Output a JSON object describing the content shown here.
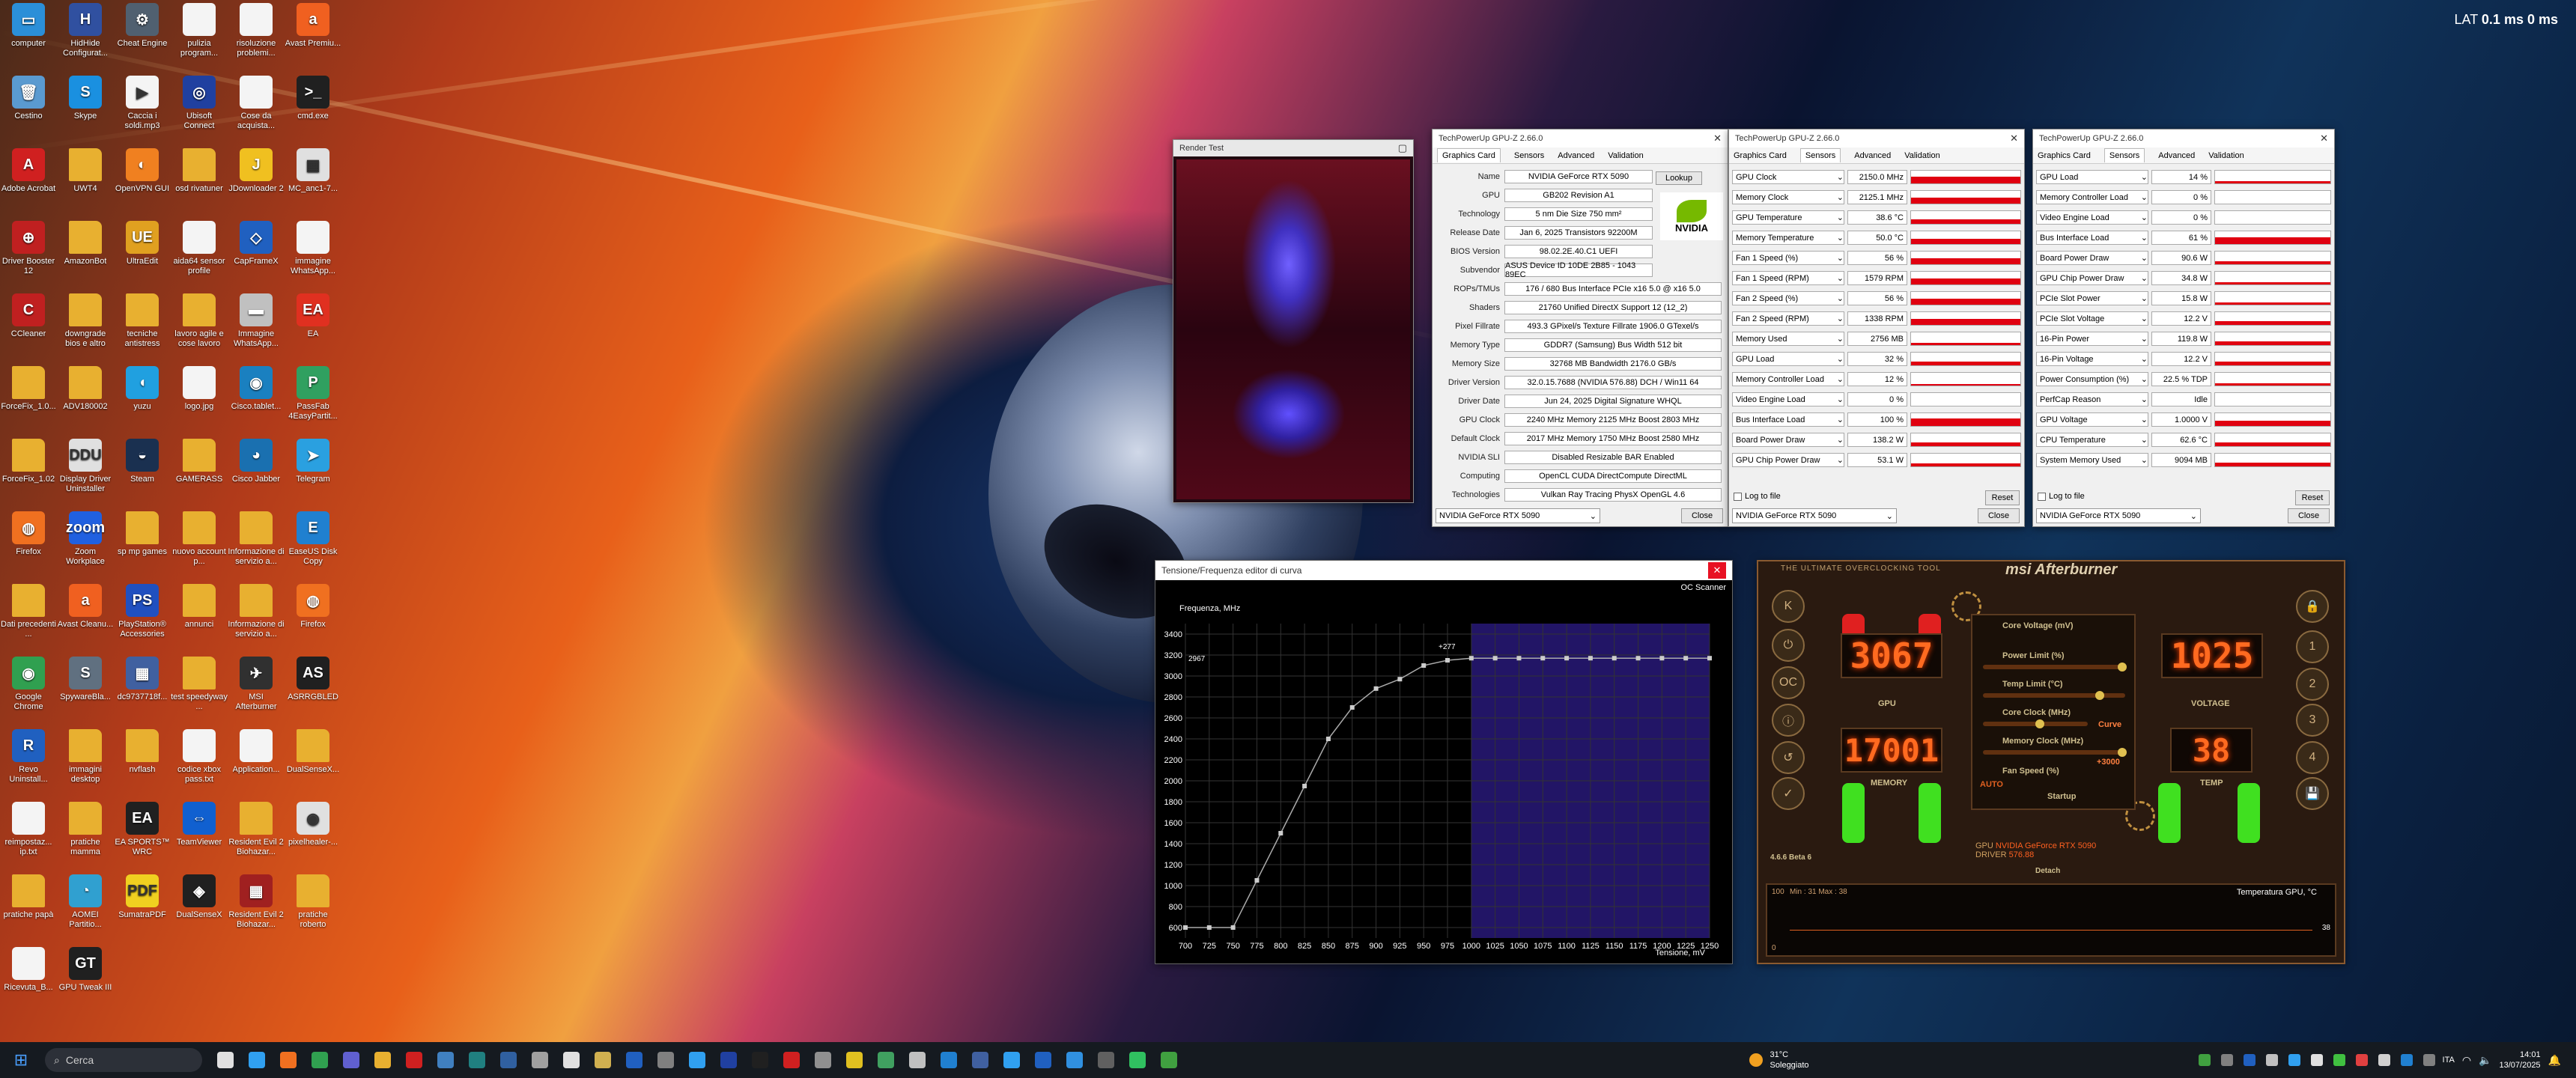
{
  "topbar": {
    "lat_label": "LAT",
    "lat_value": "0.1 ms 0 ms"
  },
  "desktop_icons": [
    {
      "label": "computer",
      "color": "#2b8fd8",
      "glyph": "▭"
    },
    {
      "label": "HidHide Configurat...",
      "color": "#3050a0",
      "glyph": "H"
    },
    {
      "label": "Cheat Engine",
      "color": "#506070",
      "glyph": "⚙"
    },
    {
      "label": "pulizia program...",
      "color": "#f4f4f4",
      "glyph": ""
    },
    {
      "label": "risoluzione problemi...",
      "color": "#f4f4f4",
      "glyph": ""
    },
    {
      "label": "Avast Premiu...",
      "color": "#f06020",
      "glyph": "a"
    },
    {
      "label": "Cestino",
      "color": "#5a9ad0",
      "glyph": "🗑"
    },
    {
      "label": "Skype",
      "color": "#1a90e0",
      "glyph": "S"
    },
    {
      "label": "Caccia i soldi.mp3",
      "color": "#f4f4f4",
      "glyph": "▶"
    },
    {
      "label": "Ubisoft Connect",
      "color": "#2040a0",
      "glyph": "◎"
    },
    {
      "label": "Cose da acquista...",
      "color": "#f4f4f4",
      "glyph": ""
    },
    {
      "label": "cmd.exe",
      "color": "#202020",
      "glyph": ">_"
    },
    {
      "label": "Adobe Acrobat",
      "color": "#d02020",
      "glyph": "A"
    },
    {
      "label": "UWT4",
      "color": "#e8b030",
      "glyph": ""
    },
    {
      "label": "OpenVPN GUI",
      "color": "#f08020",
      "glyph": "◐"
    },
    {
      "label": "osd rivatuner",
      "color": "#e8b030",
      "glyph": ""
    },
    {
      "label": "JDownloader 2",
      "color": "#f0c020",
      "glyph": "J"
    },
    {
      "label": "MC_anc1-7...",
      "color": "#e0e0e0",
      "glyph": "▦"
    },
    {
      "label": "Driver Booster 12",
      "color": "#c02020",
      "glyph": "⊕"
    },
    {
      "label": "AmazonBot",
      "color": "#e8b030",
      "glyph": ""
    },
    {
      "label": "UltraEdit",
      "color": "#e0a020",
      "glyph": "UE"
    },
    {
      "label": "aida64 sensor profile",
      "color": "#f4f4f4",
      "glyph": ""
    },
    {
      "label": "CapFrameX",
      "color": "#2060c0",
      "glyph": "◇"
    },
    {
      "label": "immagine WhatsApp...",
      "color": "#f4f4f4",
      "glyph": ""
    },
    {
      "label": "CCleaner",
      "color": "#c02020",
      "glyph": "C"
    },
    {
      "label": "downgrade bios e altro",
      "color": "#e8b030",
      "glyph": ""
    },
    {
      "label": "tecniche antistress",
      "color": "#e8b030",
      "glyph": ""
    },
    {
      "label": "lavoro agile e cose lavoro",
      "color": "#e8b030",
      "glyph": ""
    },
    {
      "label": "Immagine WhatsApp...",
      "color": "#c0c0c0",
      "glyph": "▬"
    },
    {
      "label": "EA",
      "color": "#e03020",
      "glyph": "EA"
    },
    {
      "label": "ForceFix_1.0...",
      "color": "#e8b030",
      "glyph": ""
    },
    {
      "label": "ADV180002",
      "color": "#e8b030",
      "glyph": ""
    },
    {
      "label": "yuzu",
      "color": "#20a0e0",
      "glyph": "◖"
    },
    {
      "label": "logo.jpg",
      "color": "#f4f4f4",
      "glyph": ""
    },
    {
      "label": "Cisco.tablet...",
      "color": "#1a80c0",
      "glyph": "◉"
    },
    {
      "label": "PassFab 4EasyPartit...",
      "color": "#30a060",
      "glyph": "P"
    },
    {
      "label": "ForceFix_1.02",
      "color": "#e8b030",
      "glyph": ""
    },
    {
      "label": "Display Driver Uninstaller",
      "color": "#e0e0e0",
      "glyph": "DDU"
    },
    {
      "label": "Steam",
      "color": "#1a3050",
      "glyph": "◒"
    },
    {
      "label": "GAMERASS",
      "color": "#e8b030",
      "glyph": ""
    },
    {
      "label": "Cisco Jabber",
      "color": "#1a70b0",
      "glyph": "◕"
    },
    {
      "label": "Telegram",
      "color": "#2aa0e0",
      "glyph": "➤"
    },
    {
      "label": "Firefox",
      "color": "#f07020",
      "glyph": "◍"
    },
    {
      "label": "Zoom Workplace",
      "color": "#2060e0",
      "glyph": "zoom"
    },
    {
      "label": "sp mp games",
      "color": "#e8b030",
      "glyph": ""
    },
    {
      "label": "nuovo account p...",
      "color": "#e8b030",
      "glyph": ""
    },
    {
      "label": "Informazione di servizio a...",
      "color": "#e8b030",
      "glyph": ""
    },
    {
      "label": "EaseUS Disk Copy",
      "color": "#2080d0",
      "glyph": "E"
    },
    {
      "label": "Dati precedenti ...",
      "color": "#e8b030",
      "glyph": ""
    },
    {
      "label": "Avast Cleanu...",
      "color": "#f06020",
      "glyph": "a"
    },
    {
      "label": "PlayStation® Accessories",
      "color": "#2050c0",
      "glyph": "PS"
    },
    {
      "label": "annunci",
      "color": "#e8b030",
      "glyph": ""
    },
    {
      "label": "Informazione di servizio a...",
      "color": "#e8b030",
      "glyph": ""
    },
    {
      "label": "Firefox",
      "color": "#f07020",
      "glyph": "◍"
    },
    {
      "label": "Google Chrome",
      "color": "#30a050",
      "glyph": "◉"
    },
    {
      "label": "SpywareBla...",
      "color": "#607080",
      "glyph": "S"
    },
    {
      "label": "dc9737718f...",
      "color": "#4060a0",
      "glyph": "▦"
    },
    {
      "label": "test speedyway ...",
      "color": "#e8b030",
      "glyph": ""
    },
    {
      "label": "MSI Afterburner",
      "color": "#303030",
      "glyph": "✈"
    },
    {
      "label": "ASRRGBLED",
      "color": "#202020",
      "glyph": "AS"
    },
    {
      "label": "Revo Uninstall...",
      "color": "#2060c0",
      "glyph": "R"
    },
    {
      "label": "immagini desktop",
      "color": "#e8b030",
      "glyph": ""
    },
    {
      "label": "nvflash",
      "color": "#e8b030",
      "glyph": ""
    },
    {
      "label": "codice xbox pass.txt",
      "color": "#f4f4f4",
      "glyph": ""
    },
    {
      "label": "Application...",
      "color": "#f4f4f4",
      "glyph": ""
    },
    {
      "label": "DualSenseX...",
      "color": "#e8b030",
      "glyph": ""
    },
    {
      "label": "reimpostaz... ip.txt",
      "color": "#f4f4f4",
      "glyph": ""
    },
    {
      "label": "pratiche mamma",
      "color": "#e8b030",
      "glyph": ""
    },
    {
      "label": "EA SPORTS™ WRC",
      "color": "#202020",
      "glyph": "EA"
    },
    {
      "label": "TeamViewer",
      "color": "#1060d0",
      "glyph": "⇔"
    },
    {
      "label": "Resident Evil 2 Biohazar...",
      "color": "#e8b030",
      "glyph": ""
    },
    {
      "label": "pixelhealer-...",
      "color": "#e0e0e0",
      "glyph": "◉"
    },
    {
      "label": "pratiche papà",
      "color": "#e8b030",
      "glyph": ""
    },
    {
      "label": "AOMEI Partitio...",
      "color": "#30a0d0",
      "glyph": "◔"
    },
    {
      "label": "SumatraPDF",
      "color": "#f0d020",
      "glyph": "PDF"
    },
    {
      "label": "DualSenseX",
      "color": "#202020",
      "glyph": "◈"
    },
    {
      "label": "Resident Evil 2 Biohazar...",
      "color": "#a02020",
      "glyph": "▦"
    },
    {
      "label": "pratiche roberto",
      "color": "#e8b030",
      "glyph": ""
    },
    {
      "label": "Ricevuta_B...",
      "color": "#f4f4f4",
      "glyph": ""
    },
    {
      "label": "GPU Tweak III",
      "color": "#202020",
      "glyph": "GT"
    }
  ],
  "render_test": {
    "title": "Render Test"
  },
  "gpuz1": {
    "title": "TechPowerUp GPU-Z 2.66.0",
    "tabs": [
      "Graphics Card",
      "Sensors",
      "Advanced",
      "Validation"
    ],
    "rows": [
      {
        "label": "Name",
        "value": "NVIDIA GeForce RTX 5090"
      },
      {
        "label": "GPU",
        "value": "GB202   Revision   A1"
      },
      {
        "label": "Technology",
        "value": "5 nm   Die Size   750 mm²"
      },
      {
        "label": "Release Date",
        "value": "Jan 6, 2025   Transistors   92200M"
      },
      {
        "label": "BIOS Version",
        "value": "98.02.2E.40.C1   UEFI"
      },
      {
        "label": "Subvendor",
        "value": "ASUS   Device ID   10DE 2B85 - 1043 89EC"
      },
      {
        "label": "ROPs/TMUs",
        "value": "176 / 680   Bus Interface   PCIe x16 5.0 @ x16 5.0"
      },
      {
        "label": "Shaders",
        "value": "21760 Unified   DirectX Support   12 (12_2)"
      },
      {
        "label": "Pixel Fillrate",
        "value": "493.3 GPixel/s   Texture Fillrate   1906.0 GTexel/s"
      },
      {
        "label": "Memory Type",
        "value": "GDDR7 (Samsung)   Bus Width   512 bit"
      },
      {
        "label": "Memory Size",
        "value": "32768 MB   Bandwidth   2176.0 GB/s"
      },
      {
        "label": "Driver Version",
        "value": "32.0.15.7688 (NVIDIA 576.88) DCH / Win11 64"
      },
      {
        "label": "Driver Date",
        "value": "Jun 24, 2025   Digital Signature   WHQL"
      },
      {
        "label": "GPU Clock",
        "value": "2240 MHz   Memory   2125 MHz   Boost   2803 MHz"
      },
      {
        "label": "Default Clock",
        "value": "2017 MHz   Memory   1750 MHz   Boost   2580 MHz"
      },
      {
        "label": "NVIDIA SLI",
        "value": "Disabled   Resizable BAR   Enabled"
      },
      {
        "label": "Computing",
        "value": "OpenCL   CUDA   DirectCompute   DirectML"
      },
      {
        "label": "Technologies",
        "value": "Vulkan   Ray Tracing   PhysX   OpenGL 4.6"
      }
    ],
    "lookup": "Lookup",
    "device": "NVIDIA GeForce RTX 5090",
    "close": "Close",
    "logo": "NVIDIA"
  },
  "gpuz2": {
    "title": "TechPowerUp GPU-Z 2.66.0",
    "tabs": [
      "Graphics Card",
      "Sensors",
      "Advanced",
      "Validation"
    ],
    "sensors": [
      {
        "name": "GPU Clock",
        "value": "2150.0 MHz",
        "fill": 0.55
      },
      {
        "name": "Memory Clock",
        "value": "2125.1 MHz",
        "fill": 0.45
      },
      {
        "name": "GPU Temperature",
        "value": "38.6 °C",
        "fill": 0.35
      },
      {
        "name": "Memory Temperature",
        "value": "50.0 °C",
        "fill": 0.4
      },
      {
        "name": "Fan 1 Speed (%)",
        "value": "56 %",
        "fill": 0.45
      },
      {
        "name": "Fan 1 Speed (RPM)",
        "value": "1579 RPM",
        "fill": 0.45
      },
      {
        "name": "Fan 2 Speed (%)",
        "value": "56 %",
        "fill": 0.45
      },
      {
        "name": "Fan 2 Speed (RPM)",
        "value": "1338 RPM",
        "fill": 0.45
      },
      {
        "name": "Memory Used",
        "value": "2756 MB",
        "fill": 0.15
      },
      {
        "name": "GPU Load",
        "value": "32 %",
        "fill": 0.3
      },
      {
        "name": "Memory Controller Load",
        "value": "12 %",
        "fill": 0.1
      },
      {
        "name": "Video Engine Load",
        "value": "0 %",
        "fill": 0
      },
      {
        "name": "Bus Interface Load",
        "value": "100 %",
        "fill": 0.6
      },
      {
        "name": "Board Power Draw",
        "value": "138.2 W",
        "fill": 0.3
      },
      {
        "name": "GPU Chip Power Draw",
        "value": "53.1 W",
        "fill": 0.25
      }
    ],
    "log": "Log to file",
    "reset": "Reset",
    "device": "NVIDIA GeForce RTX 5090",
    "close": "Close"
  },
  "gpuz3": {
    "title": "TechPowerUp GPU-Z 2.66.0",
    "tabs": [
      "Graphics Card",
      "Sensors",
      "Advanced",
      "Validation"
    ],
    "sensors": [
      {
        "name": "GPU Load",
        "value": "14 %",
        "fill": 0.15
      },
      {
        "name": "Memory Controller Load",
        "value": "0 %",
        "fill": 0
      },
      {
        "name": "Video Engine Load",
        "value": "0 %",
        "fill": 0
      },
      {
        "name": "Bus Interface Load",
        "value": "61 %",
        "fill": 0.55
      },
      {
        "name": "Board Power Draw",
        "value": "90.6 W",
        "fill": 0.25
      },
      {
        "name": "GPU Chip Power Draw",
        "value": "34.8 W",
        "fill": 0.2
      },
      {
        "name": "PCIe Slot Power",
        "value": "15.8 W",
        "fill": 0.2
      },
      {
        "name": "PCIe Slot Voltage",
        "value": "12.2 V",
        "fill": 0.3
      },
      {
        "name": "16-Pin Power",
        "value": "119.8 W",
        "fill": 0.3
      },
      {
        "name": "16-Pin Voltage",
        "value": "12.2 V",
        "fill": 0.3
      },
      {
        "name": "Power Consumption (%)",
        "value": "22.5 % TDP",
        "fill": 0.2
      },
      {
        "name": "PerfCap Reason",
        "value": "Idle",
        "fill": 0
      },
      {
        "name": "GPU Voltage",
        "value": "1.0000 V",
        "fill": 0.4
      },
      {
        "name": "CPU Temperature",
        "value": "62.6 °C",
        "fill": 0.3
      },
      {
        "name": "System Memory Used",
        "value": "9094 MB",
        "fill": 0.3
      }
    ],
    "log": "Log to file",
    "reset": "Reset",
    "device": "NVIDIA GeForce RTX 5090",
    "close": "Close"
  },
  "curve_editor": {
    "title": "Tensione/Frequenza editor di curva",
    "oc_scanner": "OC Scanner",
    "close": "✕",
    "ylabel": "Frequenza, MHz",
    "xlabel": "Tensione, mV",
    "marker": "+277",
    "current_freq": "2967"
  },
  "chart_data": {
    "type": "line",
    "xlabel": "Tensione, mV",
    "ylabel": "Frequenza, MHz",
    "x": [
      700,
      725,
      750,
      775,
      800,
      825,
      850,
      875,
      900,
      925,
      950,
      975,
      1000,
      1025,
      1050,
      1075,
      1100,
      1125,
      1150,
      1175,
      1200,
      1225,
      1250
    ],
    "xticks": [
      "700",
      "725",
      "750",
      "775",
      "800",
      "825",
      "850",
      "875",
      "900",
      "925",
      "950",
      "975",
      "1000",
      "1025",
      "1050",
      "1075",
      "1100",
      "1125",
      "1150",
      "1175",
      "1200",
      "1225",
      "1250"
    ],
    "yticks": [
      "600",
      "800",
      "1000",
      "1200",
      "1400",
      "1600",
      "1800",
      "2000",
      "2200",
      "2400",
      "2600",
      "2800",
      "3000",
      "3200",
      "3400"
    ],
    "ylim": [
      500,
      3500
    ],
    "xlim": [
      700,
      1250
    ],
    "series": [
      {
        "values": [
          600,
          600,
          600,
          1050,
          1500,
          1950,
          2400,
          2700,
          2880,
          2970,
          3100,
          3150,
          3170,
          3170,
          3170,
          3170,
          3170,
          3170,
          3170,
          3170,
          3170,
          3170,
          3170
        ]
      }
    ],
    "highlight_from": 1000
  },
  "afterburner": {
    "brand": "msi Afterburner",
    "tagline": "THE ULTIMATE OVERCLOCKING TOOL",
    "gpu_clock": "3067",
    "mem_clock": "17001",
    "voltage": "1025",
    "temp": "38",
    "gpu_label": "GPU",
    "mem_label": "MEMORY",
    "volt_label": "VOLTAGE",
    "temp_label": "TEMP",
    "core_voltage": "Core Voltage (mV)",
    "power_limit": "Power Limit (%)",
    "temp_limit": "Temp Limit (°C)",
    "core_clock": "Core Clock (MHz)",
    "curve": "Curve",
    "memory_clock": "Memory Clock (MHz)",
    "mem_offset": "+3000",
    "fan_speed": "Fan Speed (%)",
    "auto": "AUTO",
    "startup": "Startup",
    "gpu_name": "NVIDIA GeForce RTX 5090",
    "driver": "576.88",
    "version": "4.6.6 Beta 6",
    "detach": "Detach",
    "graph_min": "Min : 31  Max : 38",
    "graph_title": "Temperatura GPU, °C",
    "graph_scale_top": "100",
    "graph_scale_bottom": "0",
    "graph_value": "38"
  },
  "taskbar": {
    "search": "Cerca",
    "weather_temp": "31°C",
    "weather_desc": "Soleggiato",
    "lang": "ITA",
    "time": "14:01",
    "date": "13/07/2025"
  }
}
